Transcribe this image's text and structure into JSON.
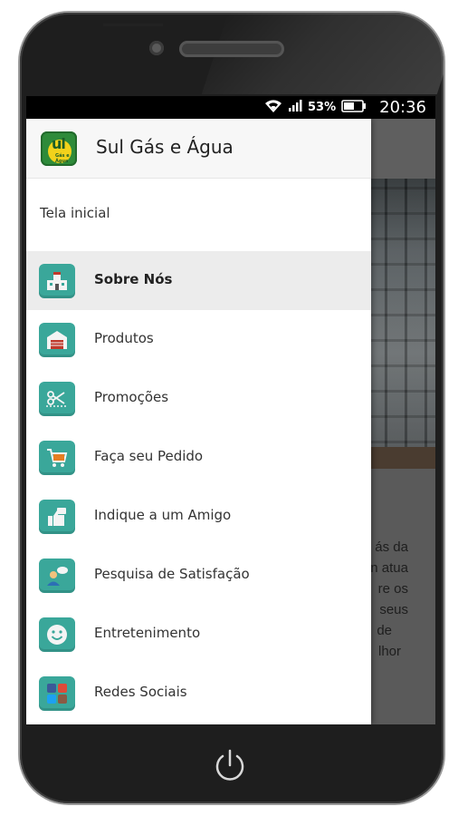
{
  "status_bar": {
    "battery_percent": "53%",
    "time": "20:36"
  },
  "drawer": {
    "app_title": "Sul Gás e Água",
    "logo_text": "ul",
    "logo_subtext": "Gás e Água",
    "home_label": "Tela inicial",
    "items": [
      {
        "label": "Sobre Nós",
        "icon": "company-building-icon",
        "active": true
      },
      {
        "label": "Produtos",
        "icon": "warehouse-icon",
        "active": false
      },
      {
        "label": "Promoções",
        "icon": "scissors-coupon-icon",
        "active": false
      },
      {
        "label": "Faça seu Pedido",
        "icon": "shopping-cart-icon",
        "active": false
      },
      {
        "label": "Indique a um Amigo",
        "icon": "thumbs-up-icon",
        "active": false
      },
      {
        "label": "Pesquisa de Satisfação",
        "icon": "survey-person-icon",
        "active": false
      },
      {
        "label": "Entretenimento",
        "icon": "smiley-face-icon",
        "active": false
      },
      {
        "label": "Redes Sociais",
        "icon": "social-networks-icon",
        "active": false
      }
    ]
  },
  "background_text_fragments": [
    "ás da",
    "n atua",
    "re os",
    "seus",
    "de",
    "lhor"
  ],
  "colors": {
    "icon_tile": "#3aa79a",
    "active_row": "#ececec",
    "logo_green": "#2e8b3a",
    "logo_yellow": "#f2d21b"
  }
}
